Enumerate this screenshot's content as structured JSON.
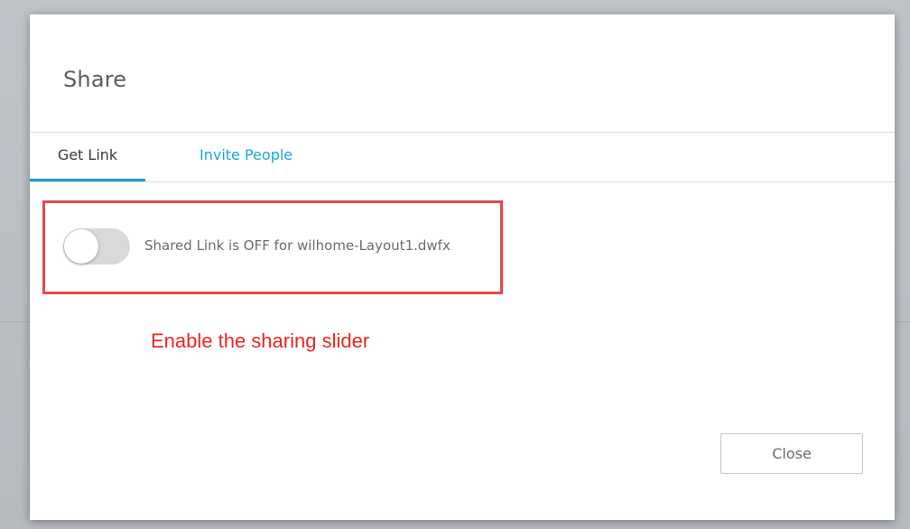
{
  "dialog": {
    "title": "Share",
    "tabs": [
      {
        "label": "Get Link",
        "active": true
      },
      {
        "label": "Invite People",
        "active": false
      }
    ],
    "shared_link": {
      "enabled": false,
      "status_text": "Shared Link is OFF for wilhome-Layout1.dwfx"
    },
    "close_label": "Close"
  },
  "annotation": {
    "text": "Enable the sharing slider",
    "color": "#ee2424"
  },
  "colors": {
    "accent": "#1e9ad6",
    "tab_link": "#1aa3dd",
    "highlight_border": "#e24a4a",
    "toggle_off": "#d9d9d9"
  }
}
